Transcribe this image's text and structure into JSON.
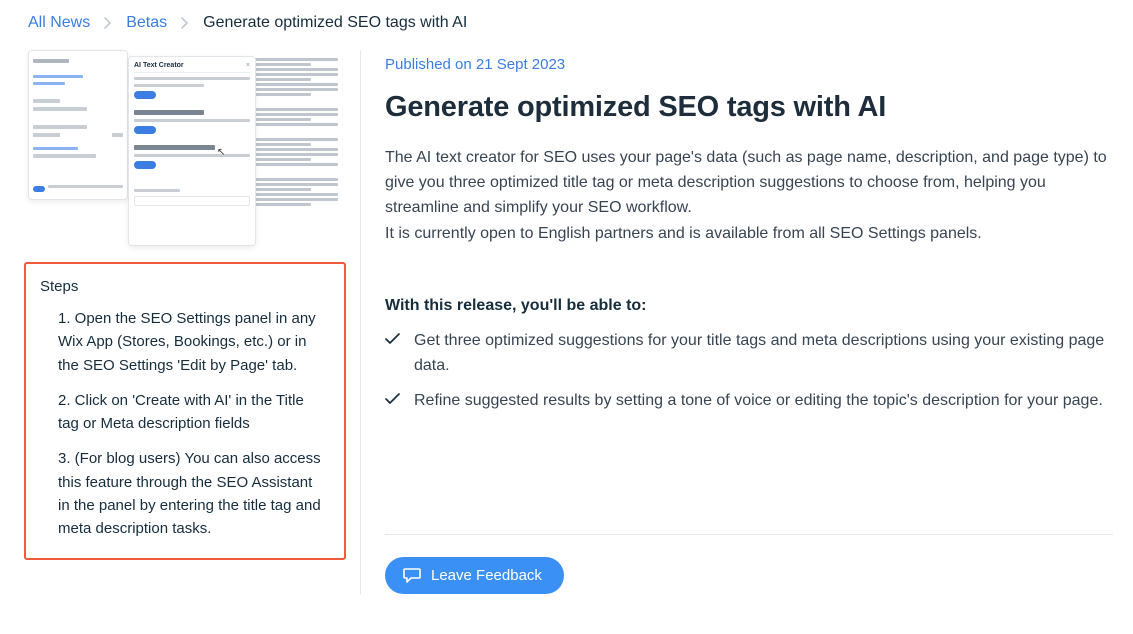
{
  "breadcrumb": {
    "root": "All News",
    "mid": "Betas",
    "current": "Generate optimized SEO tags with AI"
  },
  "published_label": "Published on 21 Sept 2023",
  "title": "Generate optimized SEO tags with AI",
  "paragraph1": "The AI text creator for SEO uses your page's data (such as page name, description, and page type)  to give you three optimized title tag or meta description suggestions to choose from, helping you streamline and simplify your SEO workflow.",
  "paragraph2": "It is currently open to English partners and is available from all SEO Settings panels.",
  "release_heading": "With this release, you'll be able to:",
  "release_items": [
    "Get three optimized suggestions for your title tags and meta descriptions using your existing page data.",
    "Refine suggested results by setting a tone of voice or editing the topic's description for your page."
  ],
  "steps": {
    "heading": "Steps",
    "items": [
      "1. Open the SEO Settings panel in any Wix App (Stores, Bookings, etc.) or in the SEO Settings 'Edit by Page' tab.",
      "2. Click on 'Create with AI' in the Title tag or Meta description fields",
      "3. (For blog users) You can also access this feature through the SEO Assistant in the panel by entering the title tag and meta description tasks."
    ]
  },
  "feedback_button": "Leave Feedback",
  "thumb_label": "AI Text Creator"
}
